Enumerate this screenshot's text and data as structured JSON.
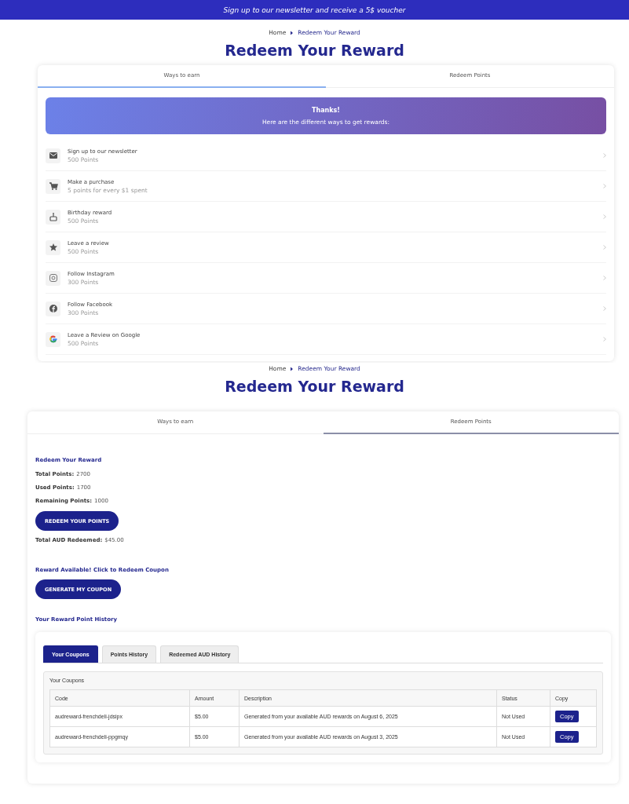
{
  "top": {
    "banner": "Sign up to our newsletter and receive a 5$ voucher",
    "breadcrumb": [
      "Home",
      "Redeem Your Reward"
    ],
    "title": "Redeem Your Reward",
    "tabs": [
      {
        "label": "Ways to earn",
        "selected": true
      },
      {
        "label": "Redeem Points",
        "selected": false
      }
    ],
    "hero": {
      "title": "Thanks!",
      "subtitle": "Here are the different ways to get rewards:"
    },
    "earn_items": [
      {
        "kind": "mail",
        "title": "Sign up to our newsletter",
        "subtitle": "500 Points"
      },
      {
        "kind": "cart",
        "title": "Make a purchase",
        "subtitle": "5 points for every $1 spent"
      },
      {
        "kind": "cake",
        "title": "Birthday reward",
        "subtitle": "500 Points"
      },
      {
        "kind": "star",
        "title": "Leave a review",
        "subtitle": "500 Points"
      },
      {
        "kind": "instagram",
        "title": "Follow Instagram",
        "subtitle": "300 Points"
      },
      {
        "kind": "facebook",
        "title": "Follow Facebook",
        "subtitle": "300 Points"
      },
      {
        "kind": "google",
        "title": "Leave a Review on Google",
        "subtitle": "500 Points"
      }
    ]
  },
  "bottom": {
    "breadcrumb": [
      "Home",
      "Redeem Your Reward"
    ],
    "title": "Redeem Your Reward",
    "tabs": [
      {
        "label": "Ways to earn",
        "selected": false
      },
      {
        "label": "Redeem Points",
        "selected": true
      }
    ],
    "section_title": "Redeem Your Reward",
    "stats": [
      {
        "label": "Total Points:",
        "value": "2700"
      },
      {
        "label": "Used Points:",
        "value": "1700"
      },
      {
        "label": "Remaining Points:",
        "value": "1000"
      }
    ],
    "redeem_button": "REDEEM YOUR POINTS",
    "total_redeemed": {
      "label": "Total AUD Redeemed:",
      "value": "$45.00"
    },
    "reward_available": "Reward Available! Click to Redeem Coupon",
    "coupon_button": "GENERATE MY COUPON",
    "history_title": "Your Reward Point History",
    "history_tabs": [
      {
        "label": "Your Coupons",
        "selected": true
      },
      {
        "label": "Points History",
        "selected": false
      },
      {
        "label": "Redeemed AUD History",
        "selected": false
      }
    ],
    "coupons": {
      "title": "Your Coupons",
      "columns": [
        "Code",
        "Amount",
        "Description",
        "Status",
        "Copy"
      ],
      "rows": [
        {
          "code": "audreward-frenchdeli-jdsipx",
          "amount": "$5.00",
          "description": "Generated from your available AUD rewards on August 6, 2025",
          "status": "Not Used",
          "copy": "Copy"
        },
        {
          "code": "audreward-frenchdeli-ppgmqy",
          "amount": "$5.00",
          "description": "Generated from your available AUD rewards on August 3, 2025",
          "status": "Not Used",
          "copy": "Copy"
        }
      ]
    }
  }
}
